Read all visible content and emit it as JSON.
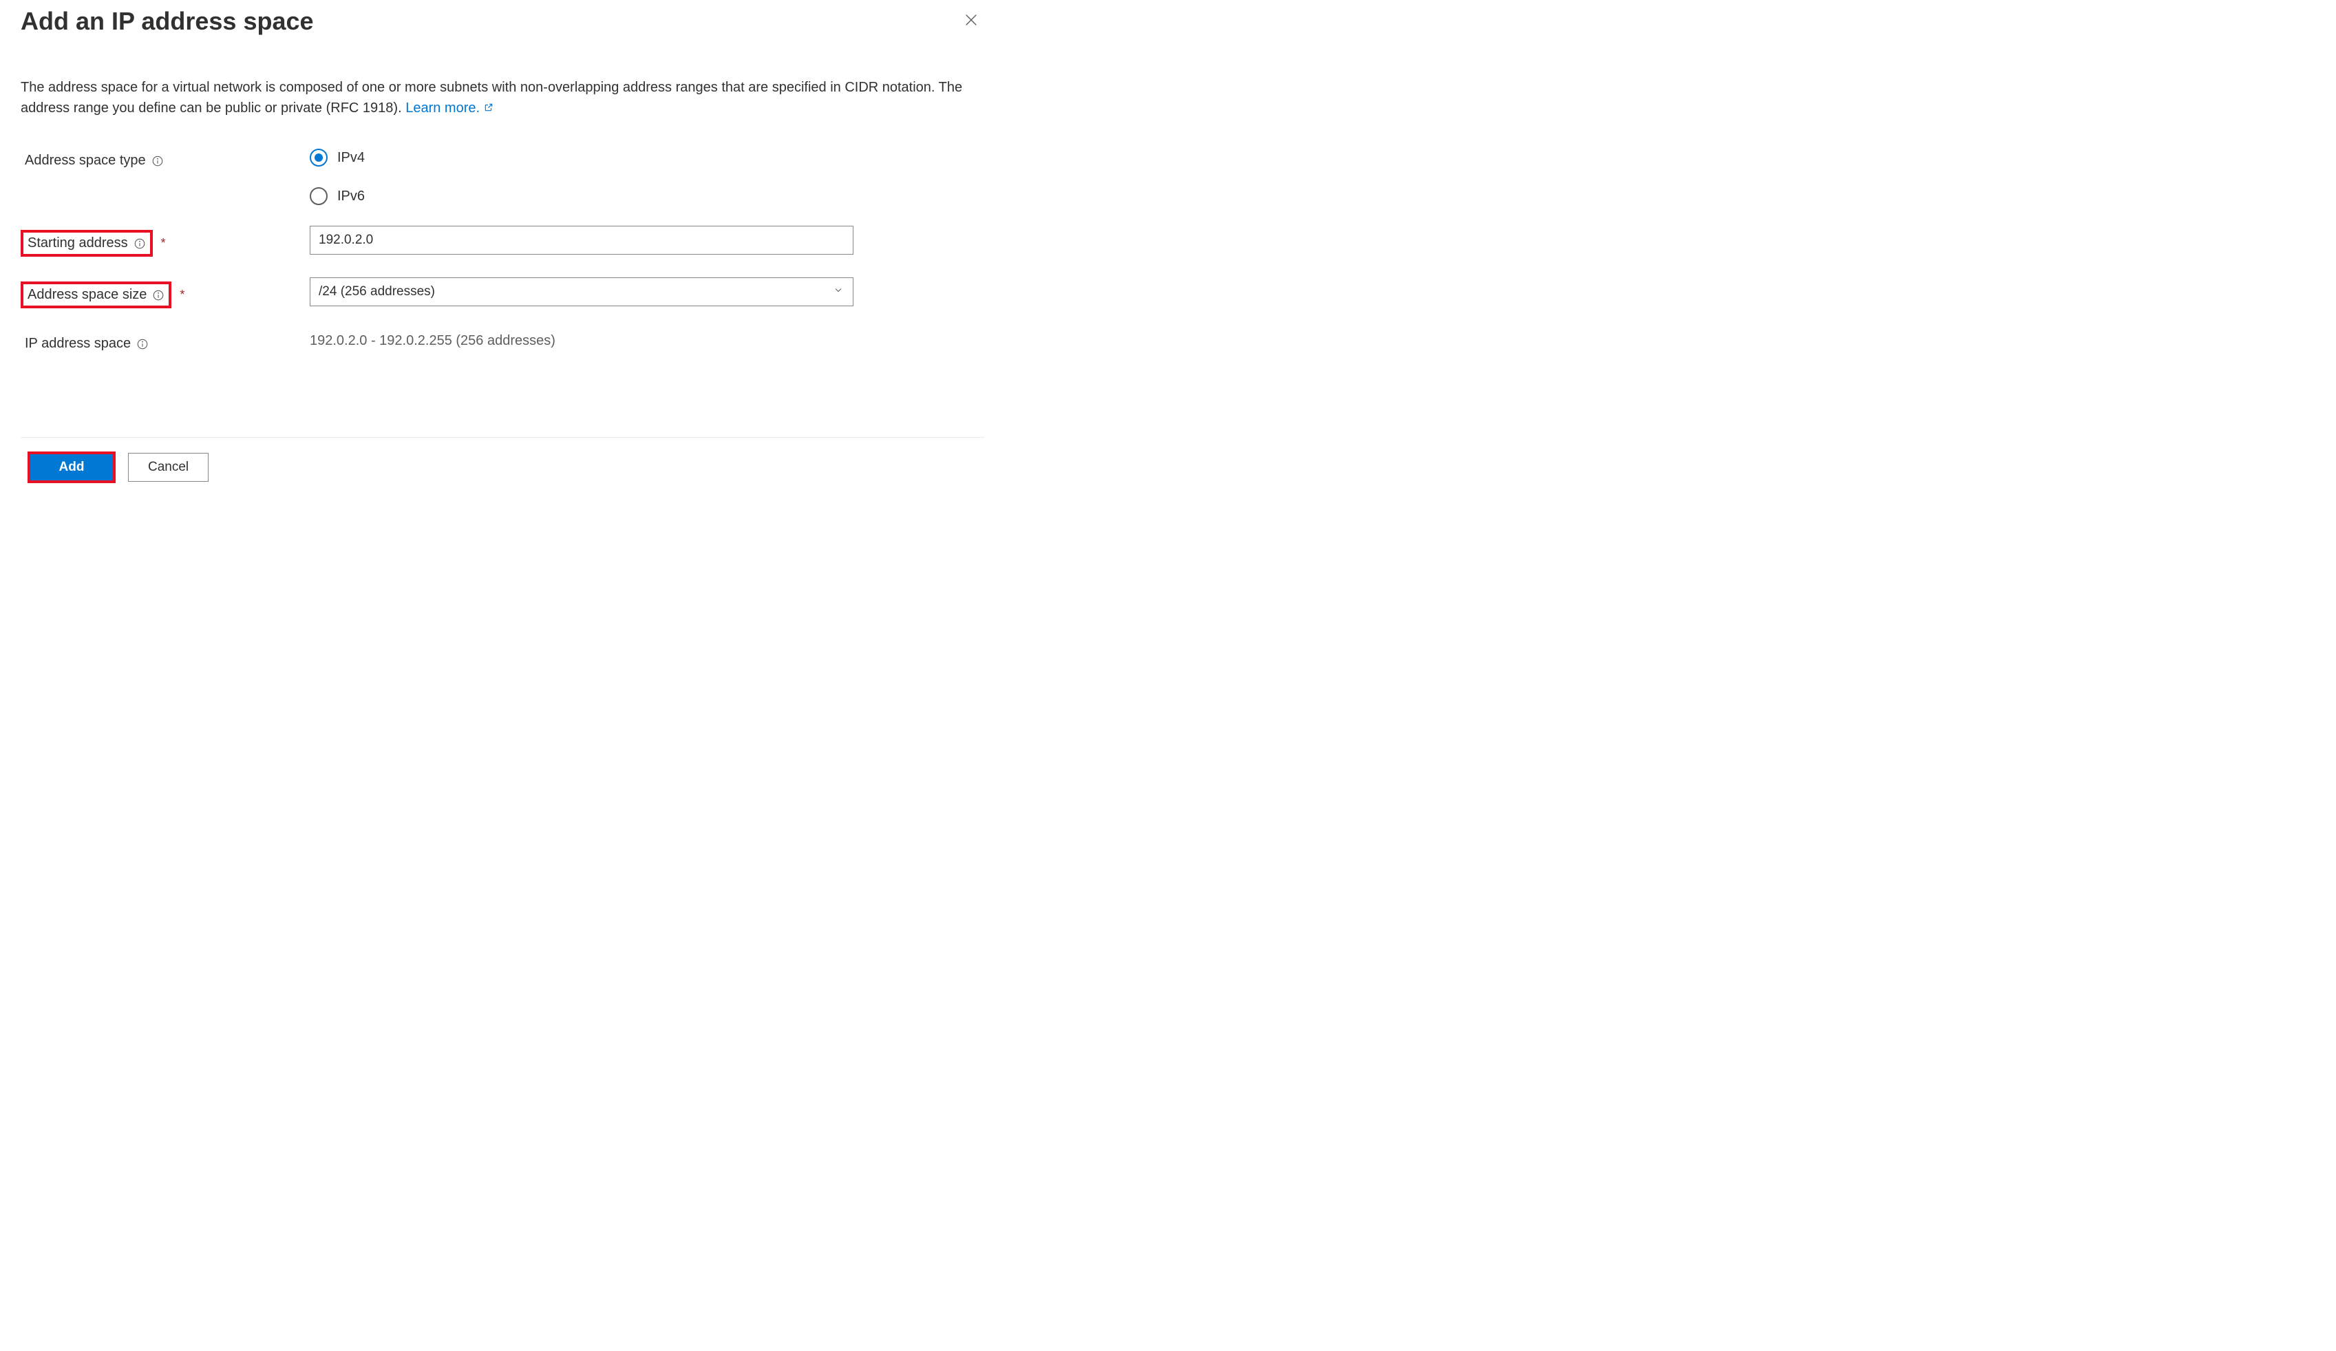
{
  "header": {
    "title": "Add an IP address space"
  },
  "description": {
    "text": "The address space for a virtual network is composed of one or more subnets with non-overlapping address ranges that are specified in CIDR notation. The address range you define can be public or private (RFC 1918).",
    "learn_more": "Learn more."
  },
  "form": {
    "address_type": {
      "label": "Address space type",
      "options": {
        "ipv4": "IPv4",
        "ipv6": "IPv6"
      },
      "selected": "ipv4"
    },
    "starting_address": {
      "label": "Starting address",
      "value": "192.0.2.0"
    },
    "space_size": {
      "label": "Address space size",
      "value": "/24 (256 addresses)"
    },
    "ip_space": {
      "label": "IP address space",
      "value": "192.0.2.0 - 192.0.2.255 (256 addresses)"
    }
  },
  "footer": {
    "add": "Add",
    "cancel": "Cancel"
  }
}
